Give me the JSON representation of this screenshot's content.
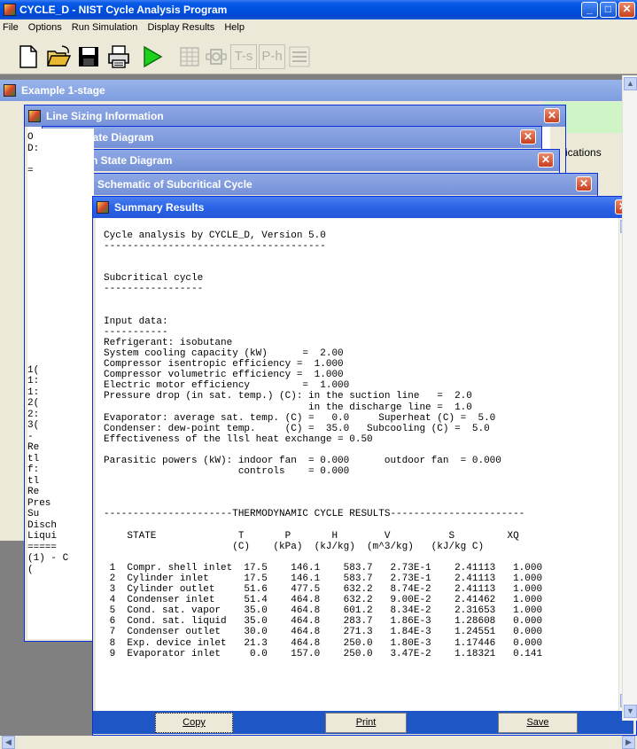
{
  "app": {
    "title": "CYCLE_D - NIST Cycle Analysis Program",
    "menu": [
      "File",
      "Options",
      "Run Simulation",
      "Display Results",
      "Help"
    ]
  },
  "toolbar": {
    "buttons": [
      "new-file-icon",
      "open-folder-icon",
      "save-disk-icon",
      "print-icon",
      "run-icon",
      "table-icon",
      "compressor-icon",
      "ts-diagram-icon",
      "ph-diagram-icon",
      "lines-icon"
    ],
    "ts_label": "T-s",
    "ph_label": "P-h"
  },
  "windows": {
    "example": "Example 1-stage",
    "line_sizing": "Line Sizing Information",
    "ts": "T-s State Diagram",
    "ph": "P-h State Diagram",
    "schematic": "Schematic of Subcritical Cycle",
    "summary": "Summary Results"
  },
  "background_text": {
    "ications": "ications",
    "left_col": [
      "O",
      "D:",
      "",
      "=",
      "",
      "",
      "",
      "",
      "",
      "",
      "",
      "",
      "",
      "",
      "",
      "",
      "",
      "",
      "",
      "",
      "",
      "1(",
      "1:",
      "1:",
      "2(",
      "2:",
      "3(",
      "-",
      "Re",
      "tl",
      "f:",
      "tl",
      "Re",
      "Pres",
      "Su",
      "Disch",
      "Liqui",
      "=====",
      "(1) - C",
      "("
    ]
  },
  "summary": {
    "text": "Cycle analysis by CYCLE_D, Version 5.0\n--------------------------------------\n\n\nSubcritical cycle\n-----------------\n\n\nInput data:\n-----------\nRefrigerant: isobutane\nSystem cooling capacity (kW)      =  2.00\nCompressor isentropic efficiency =  1.000\nCompressor volumetric efficiency =  1.000\nElectric motor efficiency         =  1.000\nPressure drop (in sat. temp.) (C): in the suction line   =  2.0\n                                   in the discharge line =  1.0\nEvaporator: average sat. temp. (C) =   0.0     Superheat (C) =  5.0\nCondenser: dew-point temp.     (C) =  35.0   Subcooling (C) =  5.0\nEffectiveness of the llsl heat exchange = 0.50\n\nParasitic powers (kW): indoor fan  = 0.000      outdoor fan  = 0.000\n                       controls    = 0.000\n\n\n\n----------------------THERMODYNAMIC CYCLE RESULTS-----------------------\n\n    STATE              T       P       H        V          S         XQ\n                      (C)    (kPa)  (kJ/kg)  (m^3/kg)   (kJ/kg C)\n\n 1  Compr. shell inlet  17.5    146.1    583.7   2.73E-1    2.41113   1.000\n 2  Cylinder inlet      17.5    146.1    583.7   2.73E-1    2.41113   1.000\n 3  Cylinder outlet     51.6    477.5    632.2   8.74E-2    2.41113   1.000\n 4  Condenser inlet     51.4    464.8    632.2   9.00E-2    2.41462   1.000\n 5  Cond. sat. vapor    35.0    464.8    601.2   8.34E-2    2.31653   1.000\n 6  Cond. sat. liquid   35.0    464.8    283.7   1.86E-3    1.28608   0.000\n 7  Condenser outlet    30.0    464.8    271.3   1.84E-3    1.24551   0.000\n 8  Exp. device inlet   21.3    464.8    250.0   1.80E-3    1.17446   0.000\n 9  Evaporator inlet     0.0    157.0    250.0   3.47E-2    1.18321   0.141",
    "buttons": {
      "copy": "Copy",
      "print": "Print",
      "save": "Save"
    }
  }
}
